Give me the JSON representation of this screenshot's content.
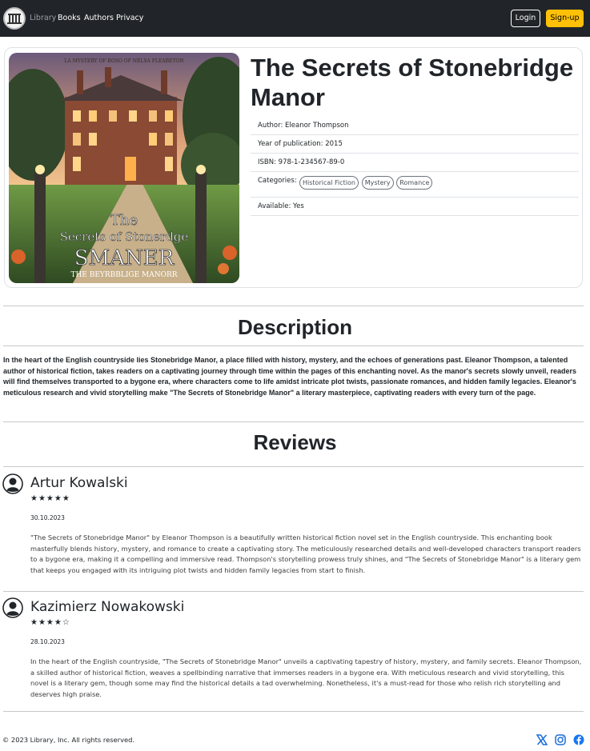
{
  "navbar": {
    "brand": "Library",
    "links": [
      "Books",
      "Authors",
      "Privacy"
    ],
    "login_label": "Login",
    "signup_label": "Sign-up",
    "logo_icon": "library-building-icon"
  },
  "book": {
    "title": "The Secrets of Stonebridge Manor",
    "author_label": "Author:",
    "author": "Eleanor Thompson",
    "year_label": "Year of publication:",
    "year": "2015",
    "isbn_label": "ISBN:",
    "isbn": "978-1-234567-89-0",
    "categories_label": "Categories:",
    "categories": [
      "Historical Fiction",
      "Mystery",
      "Romance"
    ],
    "available_label": "Available:",
    "available": "Yes",
    "cover": {
      "top_text": "LA MYSTERY OF BOSO OF NELSA FLEABETON",
      "line1": "The",
      "line2": "Secrets of Stonerdge",
      "line3": "SMANER",
      "subtitle": "THE BEYRBBLIGE MANORR"
    }
  },
  "description": {
    "heading": "Description",
    "text": "In the heart of the English countryside lies Stonebridge Manor, a place filled with history, mystery, and the echoes of generations past. Eleanor Thompson, a talented author of historical fiction, takes readers on a captivating journey through time within the pages of this enchanting novel. As the manor's secrets slowly unveil, readers will find themselves transported to a bygone era, where characters come to life amidst intricate plot twists, passionate romances, and hidden family legacies. Eleanor's meticulous research and vivid storytelling make \"The Secrets of Stonebridge Manor\" a literary masterpiece, captivating readers with every turn of the page."
  },
  "reviews": {
    "heading": "Reviews",
    "items": [
      {
        "name": "Artur Kowalski",
        "rating": 5,
        "stars": "★★★★★",
        "date": "30.10.2023",
        "text": "\"The Secrets of Stonebridge Manor\" by Eleanor Thompson is a beautifully written historical fiction novel set in the English countryside. This enchanting book masterfully blends history, mystery, and romance to create a captivating story. The meticulously researched details and well-developed characters transport readers to a bygone era, making it a compelling and immersive read. Thompson's storytelling prowess truly shines, and \"The Secrets of Stonebridge Manor\" is a literary gem that keeps you engaged with its intriguing plot twists and hidden family legacies from start to finish."
      },
      {
        "name": "Kazimierz Nowakowski",
        "rating": 4,
        "stars": "★★★★☆",
        "date": "28.10.2023",
        "text": "In the heart of the English countryside, \"The Secrets of Stonebridge Manor\" unveils a captivating tapestry of history, mystery, and family secrets. Eleanor Thompson, a skilled author of historical fiction, weaves a spellbinding narrative that immerses readers in a bygone era. With meticulous research and vivid storytelling, this novel is a literary gem, though some may find the historical details a tad overwhelming. Nonetheless, it's a must-read for those who relish rich storytelling and deserves high praise."
      }
    ]
  },
  "footer": {
    "copyright": "© 2023 Library, Inc. All rights reserved.",
    "social_icons": [
      "x-icon",
      "instagram-icon",
      "facebook-icon"
    ]
  },
  "colors": {
    "navbar_bg": "#212529",
    "signup_bg": "#ffc107",
    "facebook_blue": "#1877f2",
    "x_blue": "#1d6fd9"
  }
}
